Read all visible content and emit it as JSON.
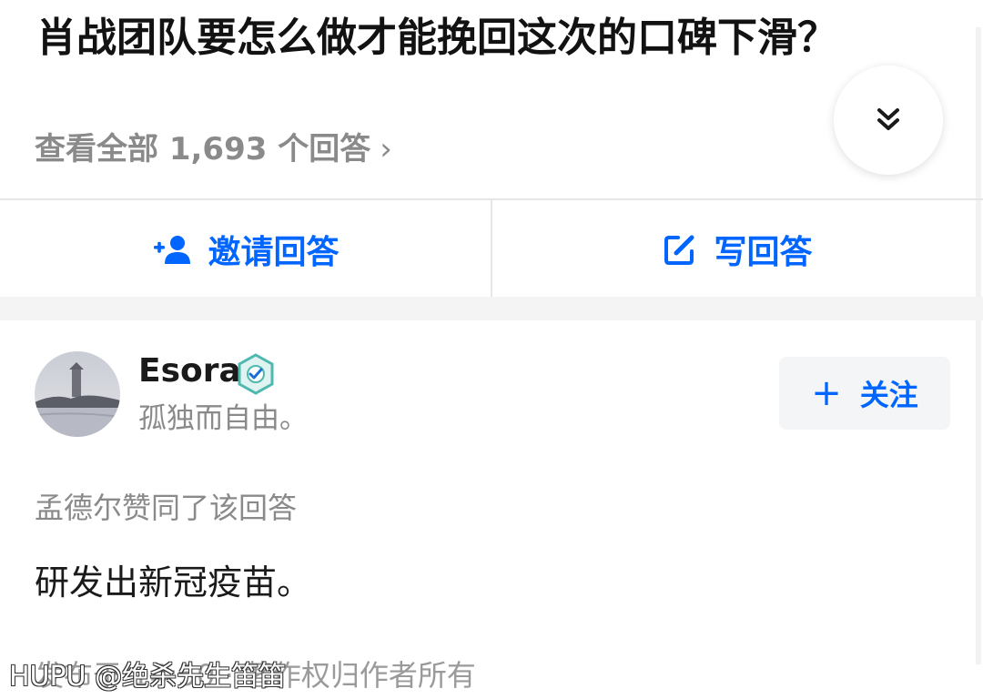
{
  "question": {
    "title": "肖战团队要怎么做才能挽回这次的口碑下滑？"
  },
  "answers_link": {
    "label": "查看全部 1,693 个回答",
    "chevron": "›"
  },
  "collapse_icon": "double-chevron-down-icon",
  "actions": {
    "invite_label": "邀请回答",
    "invite_icon": "add-person-icon",
    "write_label": "写回答",
    "write_icon": "edit-icon"
  },
  "author": {
    "name": "Esora",
    "bio": "孤独而自由。",
    "badge_icon": "verified-badge-icon"
  },
  "follow": {
    "plus": "+",
    "label": "关注"
  },
  "liked_by": "孟德尔赞同了该回答",
  "answer": {
    "text": "研发出新冠疫苗。"
  },
  "footer": {
    "text": "发布于 14:50 · 著作权归作者所有"
  },
  "watermark": "HUPU @绝杀先生笛笛",
  "colors": {
    "accent": "#0066ff",
    "muted": "#8a8a8a",
    "title": "#121212"
  }
}
